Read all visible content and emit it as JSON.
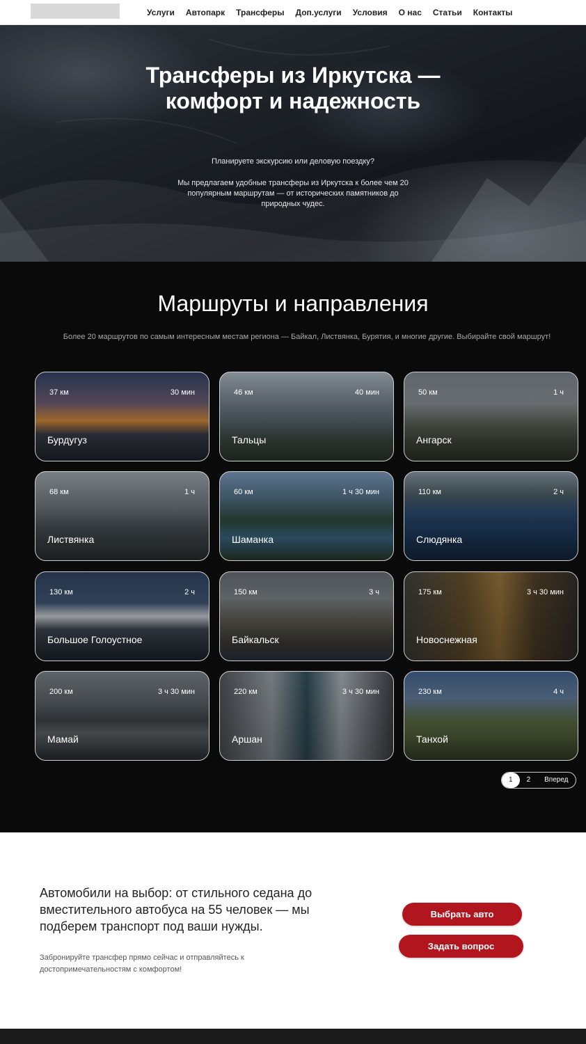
{
  "nav": {
    "items": [
      "Услуги",
      "Автопарк",
      "Трансферы",
      "Доп.услуги",
      "Условия",
      "О нас",
      "Статьи",
      "Контакты"
    ]
  },
  "hero": {
    "title_line1": "Трансферы из Иркутска —",
    "title_line2": "комфорт и надежность",
    "question": "Планируете экскурсию или деловую поездку?",
    "text": "Мы предлагаем удобные трансферы из Иркутска к более чем 20 популярным маршрутам — от исторических памятников до природных чудес."
  },
  "routes": {
    "title": "Маршруты и направления",
    "subtitle": "Более 20 маршрутов по самым интересным местам региона — Байкал, Листвянка, Бурятия, и многие другие. Выбирайте свой маршрут!",
    "cards": [
      {
        "name": "Бурдугуз",
        "km": "37 км",
        "time": "30 мин"
      },
      {
        "name": "Тальцы",
        "km": "46 км",
        "time": "40 мин"
      },
      {
        "name": "Ангарск",
        "km": "50 км",
        "time": "1 ч"
      },
      {
        "name": "Листвянка",
        "km": "68 км",
        "time": "1 ч"
      },
      {
        "name": "Шаманка",
        "km": "60 км",
        "time": "1 ч 30 мин"
      },
      {
        "name": "Слюдянка",
        "km": "110 км",
        "time": "2 ч"
      },
      {
        "name": "Большое Голоустное",
        "km": "130 км",
        "time": "2 ч"
      },
      {
        "name": "Байкальск",
        "km": "150 км",
        "time": "3 ч"
      },
      {
        "name": "Новоснежная",
        "km": "175 км",
        "time": "3 ч 30 мин"
      },
      {
        "name": "Мамай",
        "km": "200 км",
        "time": "3 ч 30 мин"
      },
      {
        "name": "Аршан",
        "km": "220 км",
        "time": "3 ч 30 мин"
      },
      {
        "name": "Танхой",
        "km": "230 км",
        "time": "4 ч"
      }
    ],
    "pager": {
      "page1": "1",
      "page2": "2",
      "next": "Вперед"
    }
  },
  "cta": {
    "heading": "Автомобили на выбор: от стильного седана до вместительного автобуса на 55 человек — мы подберем транспорт под ваши нужды.",
    "text": "Забронируйте трансфер прямо сейчас и отправляйтесь к достопримечательностям с комфортом!",
    "btn_auto": "Выбрать авто",
    "btn_ask": "Задать вопрос"
  },
  "colors": {
    "accent": "#b1151d",
    "routes_bg": "#0a0a0a"
  }
}
